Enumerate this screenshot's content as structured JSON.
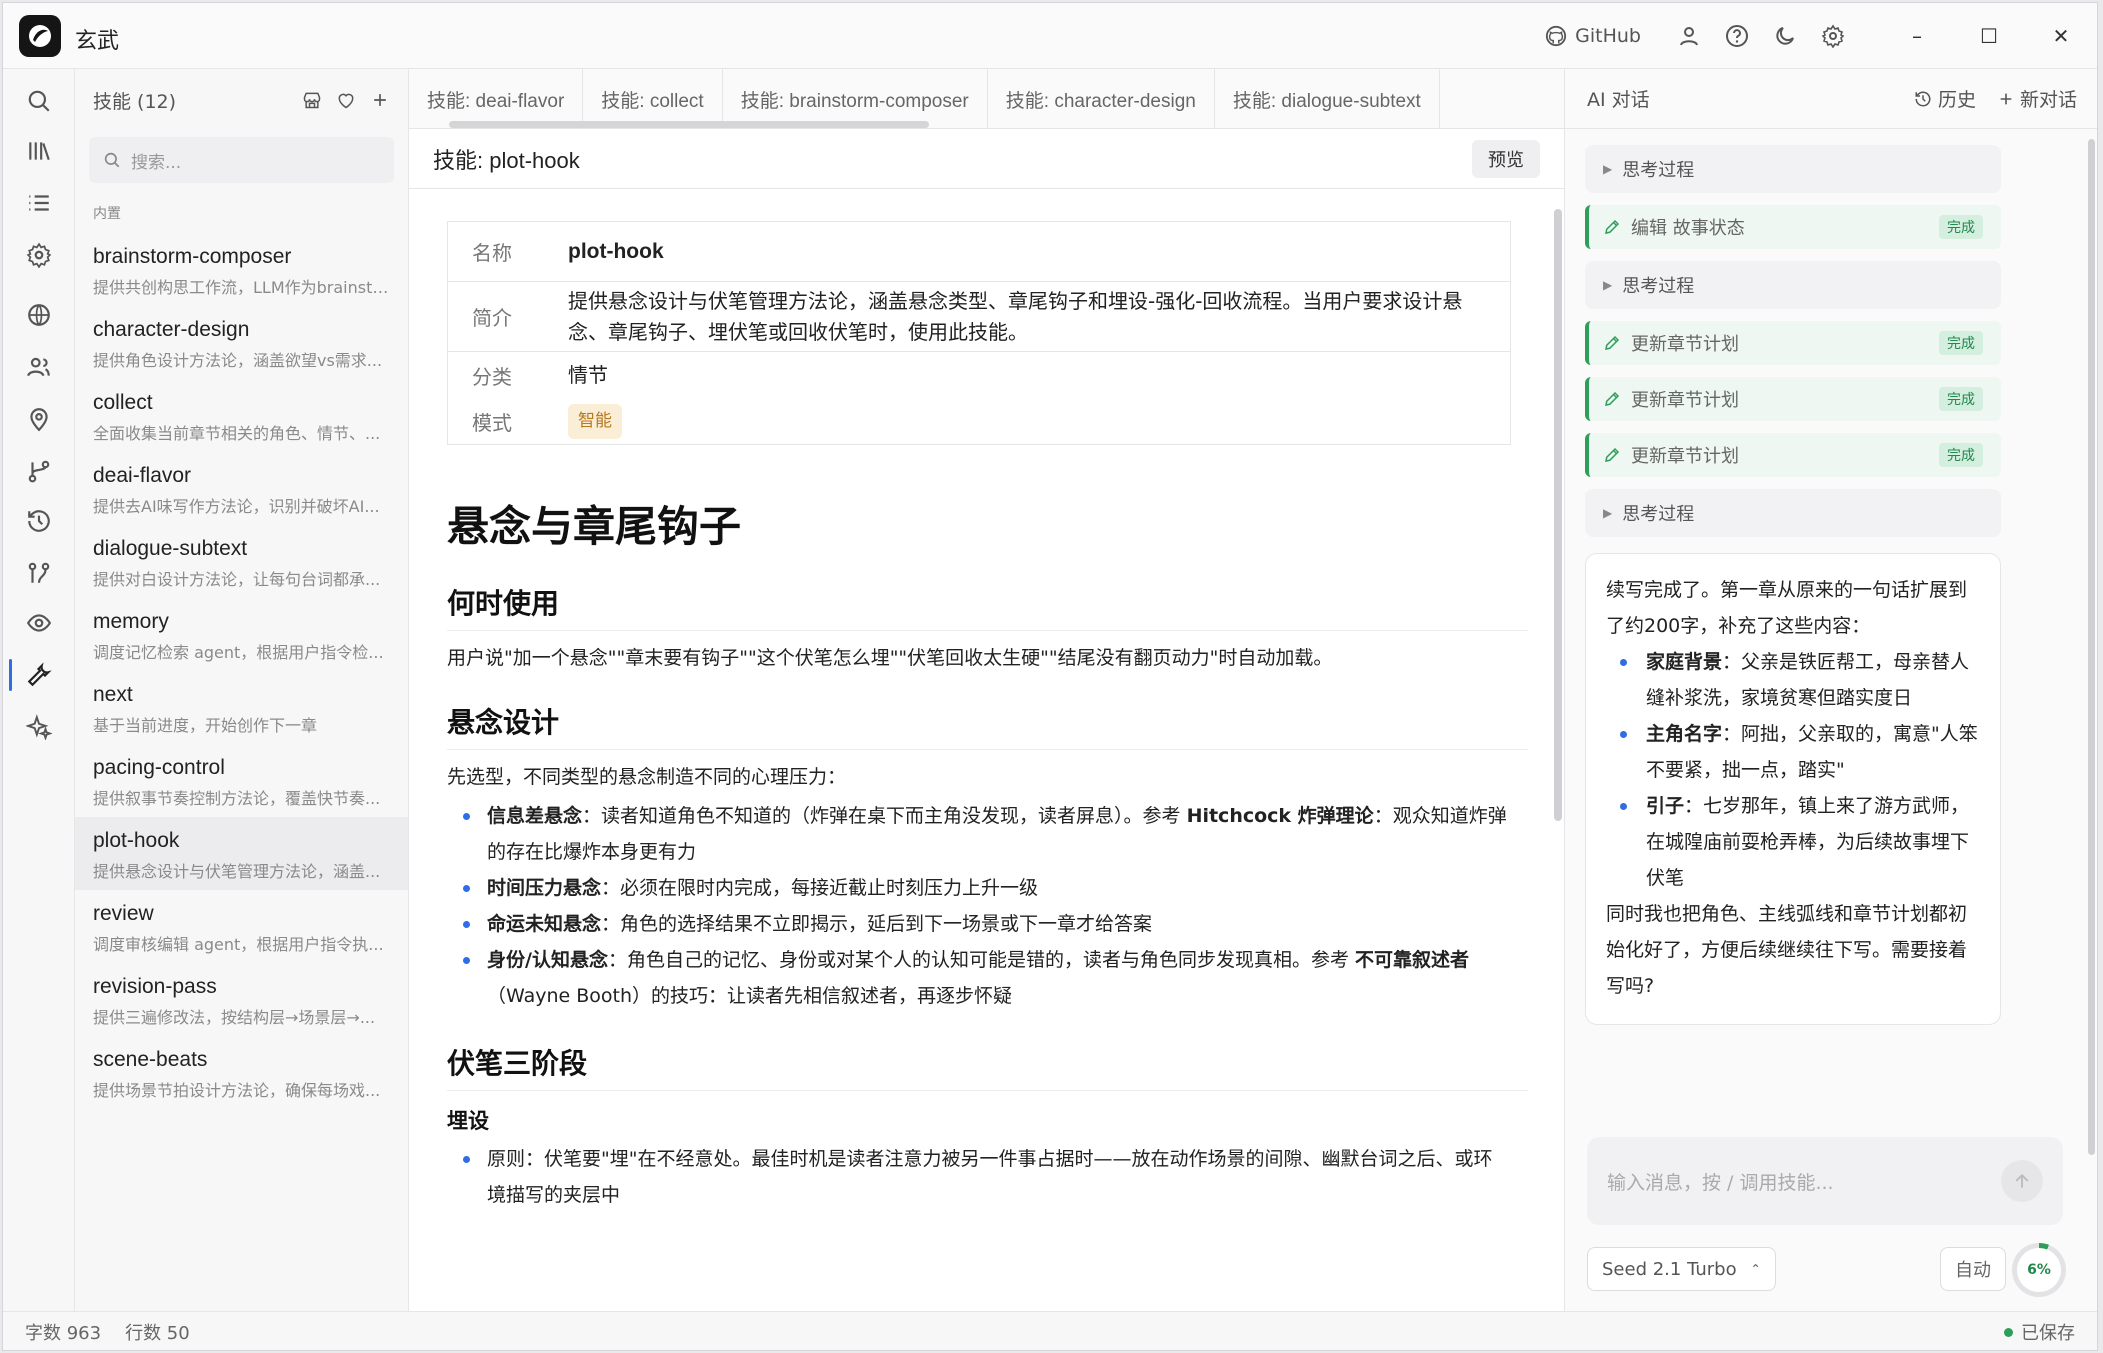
{
  "app": {
    "title": "玄武"
  },
  "titlebar": {
    "github_label": "GitHub"
  },
  "skills_panel": {
    "title": "技能 (12)",
    "search_placeholder": "搜索...",
    "section_label": "内置",
    "items": [
      {
        "name": "brainstorm-composer",
        "desc": "提供共创构思工作流，LLM作为brainstorm伙伴"
      },
      {
        "name": "character-design",
        "desc": "提供角色设计方法论，涵盖欲望vs需求..."
      },
      {
        "name": "collect",
        "desc": "全面收集当前章节相关的角色、情节、..."
      },
      {
        "name": "deai-flavor",
        "desc": "提供去AI味写作方法论，识别并破坏AI..."
      },
      {
        "name": "dialogue-subtext",
        "desc": "提供对白设计方法论，让每句台词都承..."
      },
      {
        "name": "memory",
        "desc": "调度记忆检索 agent，根据用户指令检..."
      },
      {
        "name": "next",
        "desc": "基于当前进度，开始创作下一章"
      },
      {
        "name": "pacing-control",
        "desc": "提供叙事节奏控制方法论，覆盖快节奏..."
      },
      {
        "name": "plot-hook",
        "desc": "提供悬念设计与伏笔管理方法论，涵盖..."
      },
      {
        "name": "review",
        "desc": "调度审核编辑 agent，根据用户指令执..."
      },
      {
        "name": "revision-pass",
        "desc": "提供三遍修改法，按结构层→场景层→..."
      },
      {
        "name": "scene-beats",
        "desc": "提供场景节拍设计方法论，确保每场戏..."
      }
    ]
  },
  "editor": {
    "tabs": [
      "技能: deai-flavor",
      "技能: collect",
      "技能: brainstorm-composer",
      "技能: character-design",
      "技能: dialogue-subtext"
    ],
    "file_title": "技能: plot-hook",
    "preview_label": "预览",
    "meta": {
      "name_key": "名称",
      "name_val": "plot-hook",
      "intro_key": "简介",
      "intro_val": "提供悬念设计与伏笔管理方法论，涵盖悬念类型、章尾钩子和埋设-强化-回收流程。当用户要求设计悬念、章尾钩子、埋伏笔或回收伏笔时，使用此技能。",
      "cat_key": "分类",
      "cat_val": "情节",
      "mode_key": "模式",
      "mode_val": "智能"
    },
    "doc": {
      "h1": "悬念与章尾钩子",
      "h2_when": "何时使用",
      "p_when": "用户说\"加一个悬念\"\"章末要有钩子\"\"这个伏笔怎么埋\"\"伏笔回收太生硬\"\"结尾没有翻页动力\"时自动加载。",
      "h2_design": "悬念设计",
      "p_design": "先选型，不同类型的悬念制造不同的心理压力：",
      "li1_b": "信息差悬念",
      "li1_t": "：读者知道角色不知道的（炸弹在桌下而主角没发现，读者屏息）。参考 ",
      "li1_b2": "Hitchcock 炸弹理论",
      "li1_t2": "：观众知道炸弹的存在比爆炸本身更有力",
      "li2_b": "时间压力悬念",
      "li2_t": "：必须在限时内完成，每接近截止时刻压力上升一级",
      "li3_b": "命运未知悬念",
      "li3_t": "：角色的选择结果不立即揭示，延后到下一场景或下一章才给答案",
      "li4_b": "身份/认知悬念",
      "li4_t": "：角色自己的记忆、身份或对某个人的认知可能是错的，读者与角色同步发现真相。参考 ",
      "li4_b2": "不可靠叙述者",
      "li4_t2": "（Wayne Booth）的技巧：让读者先相信叙述者，再逐步怀疑",
      "h2_fs": "伏笔三阶段",
      "h3_plant": "埋设",
      "li5_t": "原则：伏笔要\"埋\"在不经意处。最佳时机是读者注意力被另一件事占据时——放在动作场景的间隙、幽默台词之后、或环境描写的夹层中"
    }
  },
  "ai_panel": {
    "title": "AI 对话",
    "history_label": "历史",
    "new_chat_label": "新对话",
    "think_label": "思考过程",
    "done_label": "完成",
    "tool_edit": "编辑 故事状态",
    "tool_update": "更新章节计划",
    "message": {
      "intro": "续写完成了。第一章从原来的一句话扩展到了约200字，补充了这些内容：",
      "b1": "家庭背景",
      "t1": "：父亲是铁匠帮工，母亲替人缝补浆洗，家境贫寒但踏实度日",
      "b2": "主角名字",
      "t2": "：阿拙，父亲取的，寓意\"人笨不要紧，拙一点，踏实\"",
      "b3": "引子",
      "t3": "：七岁那年，镇上来了游方武师，在城隍庙前耍枪弄棒，为后续故事埋下伏笔",
      "outro": "同时我也把角色、主线弧线和章节计划都初始化好了，方便后续继续往下写。需要接着写吗?"
    },
    "composer_placeholder": "输入消息，按 / 调用技能...",
    "model_label": "Seed 2.1 Turbo",
    "auto_label": "自动",
    "context_percent": "6%"
  },
  "statusbar": {
    "chars": "字数 963",
    "lines": "行数 50",
    "saved": "已保存"
  },
  "colors": {
    "accent": "#2f6de5",
    "success": "#2e9e5b",
    "badge": "#b7791f"
  }
}
